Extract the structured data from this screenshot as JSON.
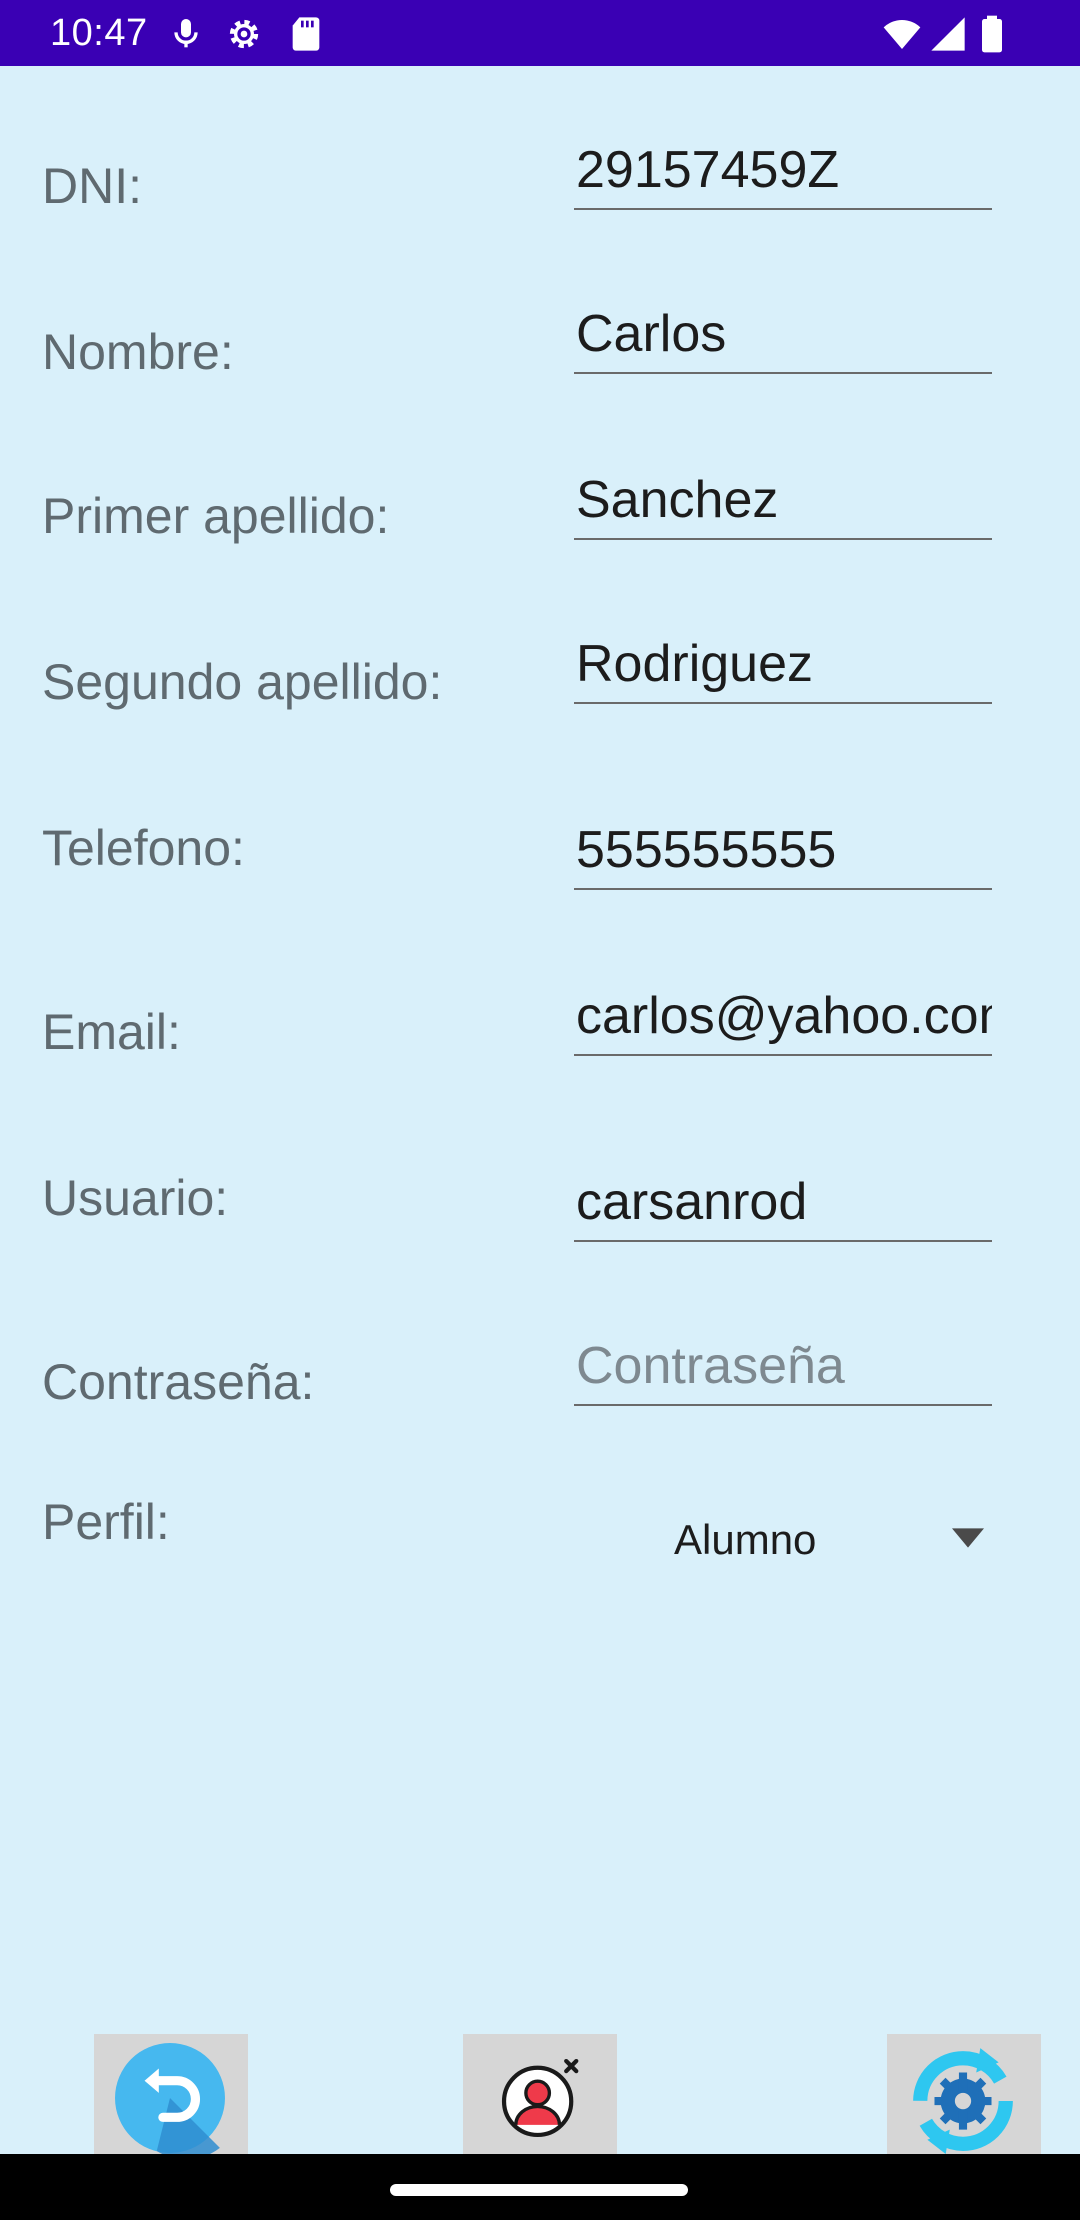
{
  "status_bar": {
    "time": "10:47",
    "background_color": "#3a00b4",
    "icons": [
      "microphone-icon",
      "settings-gear-icon",
      "sd-card-icon",
      "wifi-icon",
      "cell-signal-icon",
      "battery-icon"
    ]
  },
  "form": {
    "fields": [
      {
        "label": "DNI:",
        "value": "29157459Z",
        "placeholder": ""
      },
      {
        "label": "Nombre:",
        "value": "Carlos",
        "placeholder": ""
      },
      {
        "label": "Primer apellido:",
        "value": "Sanchez",
        "placeholder": ""
      },
      {
        "label": "Segundo apellido:",
        "value": "Rodriguez",
        "placeholder": ""
      },
      {
        "label": "Telefono:",
        "value": "555555555",
        "placeholder": ""
      },
      {
        "label": "Email:",
        "value": "carlos@yahoo.com",
        "placeholder": ""
      },
      {
        "label": "Usuario:",
        "value": "carsanrod",
        "placeholder": ""
      },
      {
        "label": "Contraseña:",
        "value": "",
        "placeholder": "Contraseña"
      }
    ],
    "profile": {
      "label": "Perfil:",
      "selected": "Alumno"
    }
  },
  "buttons": {
    "back": {
      "icon": "back-arrow-icon"
    },
    "delete_user": {
      "icon": "remove-user-icon"
    },
    "update": {
      "icon": "refresh-settings-icon"
    }
  },
  "colors": {
    "background": "#d9f0fa",
    "label_text": "#5f6a70",
    "button_background": "#d6d6d6",
    "accent_blue": "#3fb4f0"
  }
}
